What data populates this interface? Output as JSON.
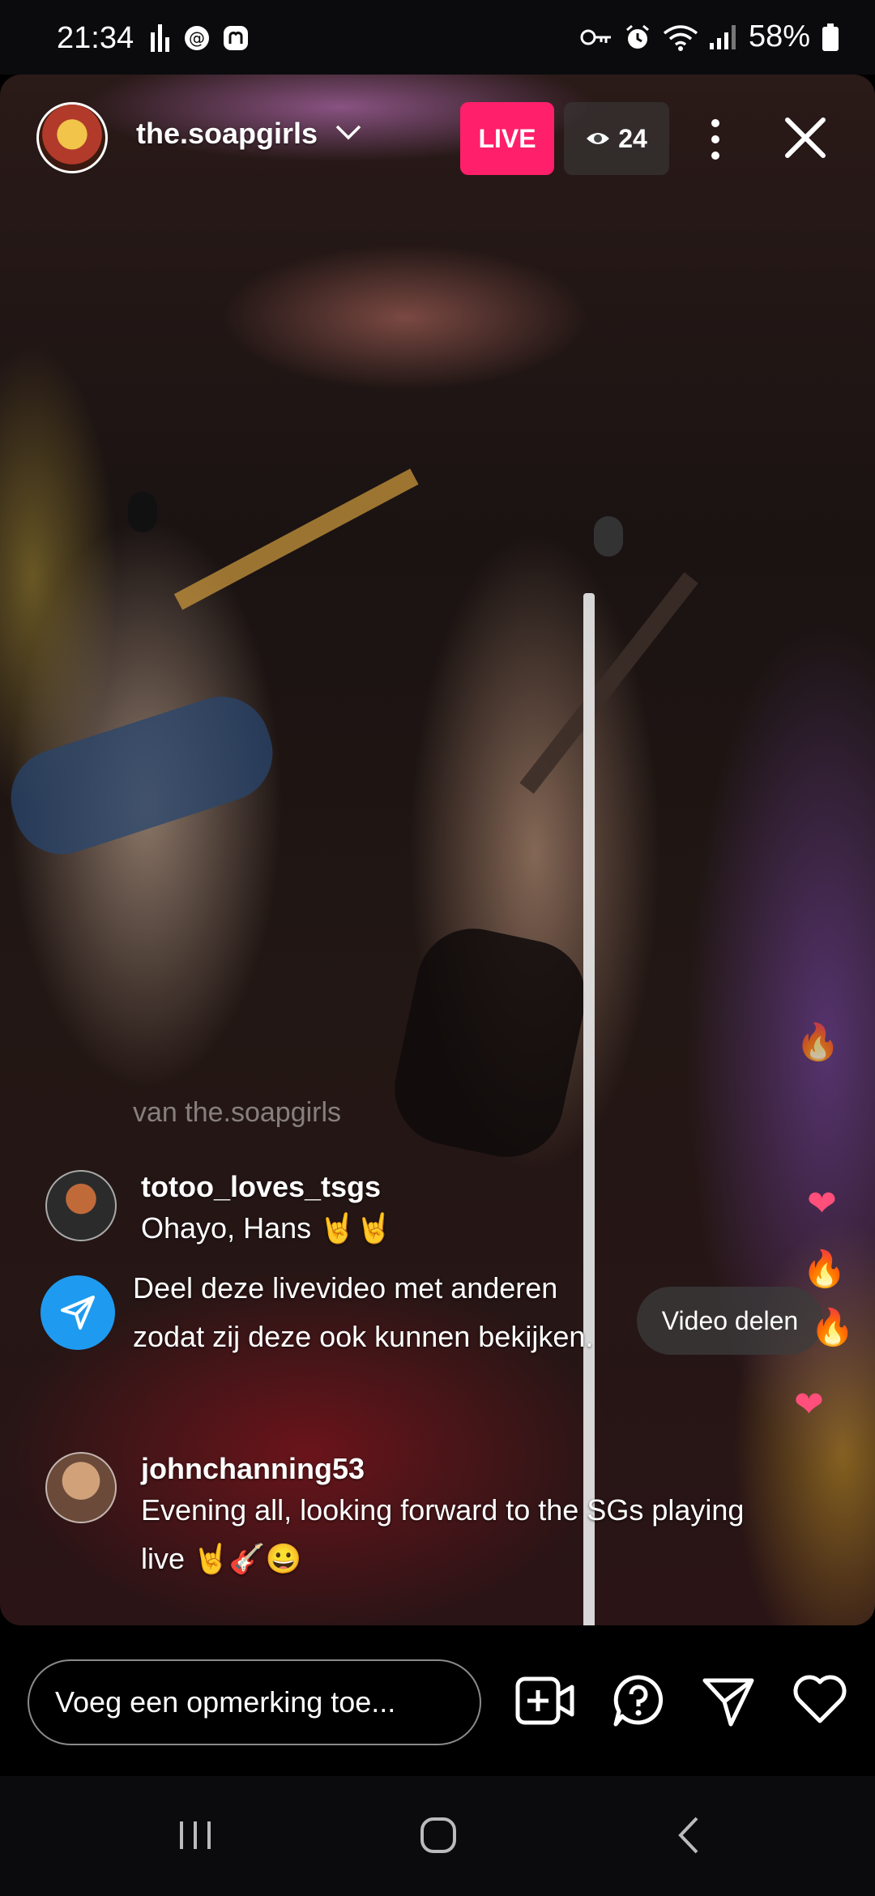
{
  "status_bar": {
    "time": "21:34",
    "battery_percent": "58%",
    "icons": [
      "bars-icon",
      "threads-icon",
      "mastodon-icon",
      "key-icon",
      "alarm-icon",
      "wifi-icon",
      "signal-icon",
      "battery-icon"
    ]
  },
  "live": {
    "username": "the.soapgirls",
    "live_label": "LIVE",
    "viewer_count": "24",
    "watermark": "van the.soapgirls"
  },
  "comments": [
    {
      "user": "totoo_loves_tsgs",
      "text": "Ohayo, Hans 🤘🤘"
    },
    {
      "user": "johnchanning53",
      "text": "Evening all, looking forward to the SGs playing live 🤘🎸😀"
    }
  ],
  "share_prompt": {
    "text": "Deel deze livevideo met anderen zodat zij deze ook kunnen bekijken.",
    "button_label": "Video delen"
  },
  "reactions": [
    "🔥",
    "❤",
    "🔥",
    "🔥",
    "❤"
  ],
  "comment_bar": {
    "placeholder": "Voeg een opmerking toe..."
  },
  "colors": {
    "live_badge": "#ff1f6b",
    "share_circle": "#1e9bf0"
  }
}
